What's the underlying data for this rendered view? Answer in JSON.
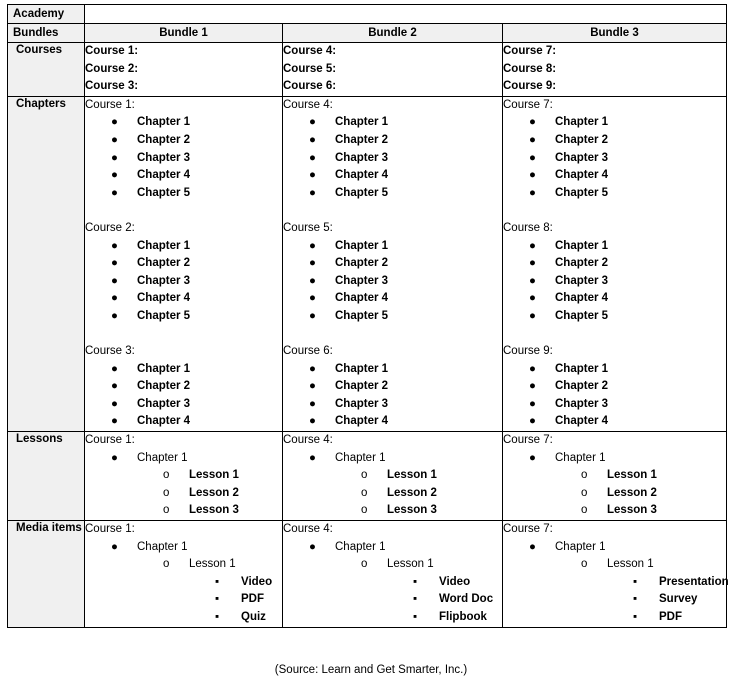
{
  "header": {
    "academy_label": "Academy",
    "bundles_label": "Bundles",
    "bundle_columns": [
      "Bundle 1",
      "Bundle 2",
      "Bundle 3"
    ]
  },
  "row_labels": {
    "courses": "Courses",
    "chapters": "Chapters",
    "lessons": "Lessons",
    "media_items": "Media items"
  },
  "markers": {
    "disc": "●",
    "circle": "o",
    "square": "▪"
  },
  "courses_row": {
    "bundle1": [
      "Course 1:",
      "Course 2:",
      "Course 3:"
    ],
    "bundle2": [
      "Course 4:",
      "Course 5:",
      "Course 6:"
    ],
    "bundle3": [
      "Course 7:",
      "Course 8:",
      "Course 9:"
    ]
  },
  "chapters_row": {
    "bundle1": [
      {
        "course": "Course 1:",
        "chapters": [
          "Chapter 1",
          "Chapter 2",
          "Chapter 3",
          "Chapter 4",
          "Chapter 5"
        ]
      },
      {
        "course": "Course 2:",
        "chapters": [
          "Chapter 1",
          "Chapter 2",
          "Chapter 3",
          "Chapter 4",
          "Chapter 5"
        ]
      },
      {
        "course": "Course 3:",
        "chapters": [
          "Chapter 1",
          "Chapter 2",
          "Chapter 3",
          "Chapter 4"
        ]
      }
    ],
    "bundle2": [
      {
        "course": "Course 4:",
        "chapters": [
          "Chapter 1",
          "Chapter 2",
          "Chapter 3",
          "Chapter 4",
          "Chapter 5"
        ]
      },
      {
        "course": "Course 5:",
        "chapters": [
          "Chapter 1",
          "Chapter 2",
          "Chapter 3",
          "Chapter 4",
          "Chapter 5"
        ]
      },
      {
        "course": "Course 6:",
        "chapters": [
          "Chapter 1",
          "Chapter 2",
          "Chapter 3",
          "Chapter 4"
        ]
      }
    ],
    "bundle3": [
      {
        "course": "Course 7:",
        "chapters": [
          "Chapter 1",
          "Chapter 2",
          "Chapter 3",
          "Chapter 4",
          "Chapter 5"
        ]
      },
      {
        "course": "Course 8:",
        "chapters": [
          "Chapter 1",
          "Chapter 2",
          "Chapter 3",
          "Chapter 4",
          "Chapter 5"
        ]
      },
      {
        "course": "Course 9:",
        "chapters": [
          "Chapter 1",
          "Chapter 2",
          "Chapter 3",
          "Chapter 4"
        ]
      }
    ]
  },
  "lessons_row": {
    "bundle1": {
      "course": "Course 1:",
      "chapter": "Chapter 1",
      "lessons": [
        "Lesson 1",
        "Lesson 2",
        "Lesson 3"
      ]
    },
    "bundle2": {
      "course": "Course 4:",
      "chapter": "Chapter 1",
      "lessons": [
        "Lesson 1",
        "Lesson 2",
        "Lesson 3"
      ]
    },
    "bundle3": {
      "course": "Course 7:",
      "chapter": "Chapter 1",
      "lessons": [
        "Lesson 1",
        "Lesson 2",
        "Lesson 3"
      ]
    }
  },
  "media_row": {
    "bundle1": {
      "course": "Course 1:",
      "chapter": "Chapter 1",
      "lesson": "Lesson 1",
      "media": [
        "Video",
        "PDF",
        "Quiz"
      ]
    },
    "bundle2": {
      "course": "Course 4:",
      "chapter": "Chapter 1",
      "lesson": "Lesson 1",
      "media": [
        "Video",
        "Word Doc",
        "Flipbook"
      ]
    },
    "bundle3": {
      "course": "Course 7:",
      "chapter": "Chapter 1",
      "lesson": "Lesson 1",
      "media": [
        "Presentation",
        "Survey",
        "PDF"
      ]
    }
  },
  "source_caption": "(Source: Learn and Get Smarter, Inc.)",
  "colors": {
    "header_fill": "#F0F0F0",
    "border": "#000000",
    "text": "#000000",
    "page_background": "#FFFFFF"
  }
}
